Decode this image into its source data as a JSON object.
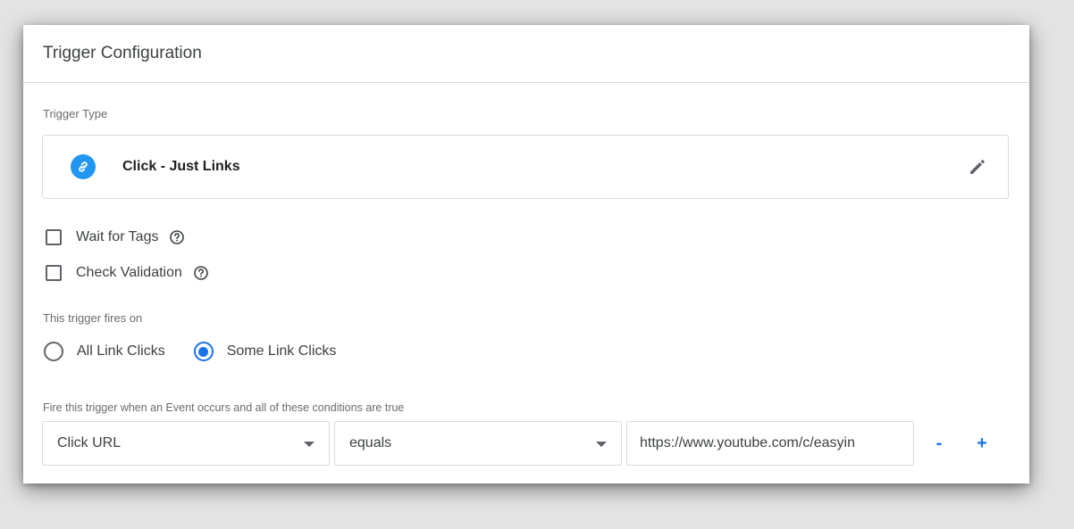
{
  "header": {
    "title": "Trigger Configuration"
  },
  "trigger_type": {
    "label": "Trigger Type",
    "name": "Click - Just Links",
    "icon": "link-icon",
    "icon_color": "#2196f3"
  },
  "options": {
    "wait_for_tags": {
      "label": "Wait for Tags",
      "checked": false
    },
    "check_validation": {
      "label": "Check Validation",
      "checked": false
    }
  },
  "fires_on": {
    "label": "This trigger fires on",
    "all": "All Link Clicks",
    "some": "Some Link Clicks",
    "selected": "some"
  },
  "conditions": {
    "label": "Fire this trigger when an Event occurs and all of these conditions are true",
    "variable": "Click URL",
    "operator": "equals",
    "value": "https://www.youtube.com/c/easyin",
    "remove_label": "-",
    "add_label": "+"
  },
  "colors": {
    "accent": "#1a73e8"
  }
}
